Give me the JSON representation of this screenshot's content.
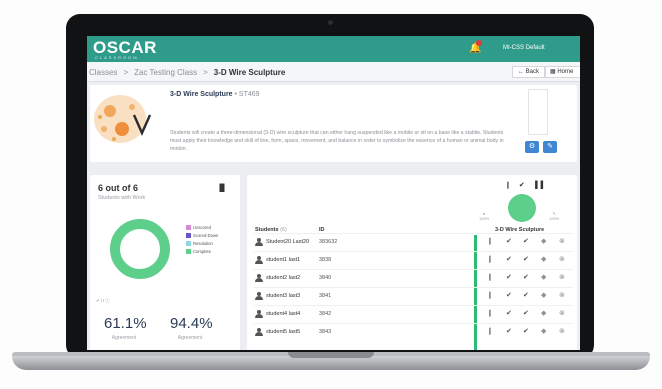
{
  "app": {
    "logo": "OSCAR",
    "logo_sub": "CLASSROOM",
    "user": "MI-CSS Default"
  },
  "breadcrumb": {
    "items": [
      "Classes",
      "Zac Testing Class",
      "3-D Wire Sculpture"
    ]
  },
  "nav": {
    "back_label": "Back",
    "home_label": "Home"
  },
  "assignment": {
    "title": "3-D Wire Sculpture",
    "code": "• ST469",
    "description": "Students will create a three-dimensional (3-D) wire sculpture that can either hang suspended like a mobile or sit on a base like a stabile. Students must apply their knowledge and skill of line, form, space, movement, and balance in order to symbolize the essence of a human or animal body in motion."
  },
  "stats": {
    "count_label": "6 out of 6",
    "sub_label": "Students with Work",
    "legend": [
      {
        "label": "Unscored",
        "color": "#d98cd5"
      },
      {
        "label": "Scored-Down",
        "color": "#6b55c9"
      },
      {
        "label": "Resolution",
        "color": "#8fd7e6"
      },
      {
        "label": "Complete",
        "color": "#5ecf8a"
      }
    ],
    "donut_complete_fraction": 1.0,
    "footer_note": "✔ i t ⓘ",
    "agreement_1": "61.1%",
    "agreement_1_label": "Agreement",
    "agreement_2": "94.4%",
    "agreement_2_label": "Agreement"
  },
  "table": {
    "header_icons": "❙ ✔ ▐",
    "mini_left": "100%",
    "mini_right": "100%",
    "col_students": "Students",
    "col_students_count": "(6)",
    "col_id": "ID",
    "col_assignment": "3-D Wire Sculpture",
    "rows": [
      {
        "name": "Student20 Last20",
        "id": "383632"
      },
      {
        "name": "student1 last1",
        "id": "3838"
      },
      {
        "name": "student2 last2",
        "id": "3840"
      },
      {
        "name": "student3 last3",
        "id": "3841"
      },
      {
        "name": "student4 last4",
        "id": "3842"
      },
      {
        "name": "student5 last5",
        "id": "3843"
      }
    ]
  }
}
